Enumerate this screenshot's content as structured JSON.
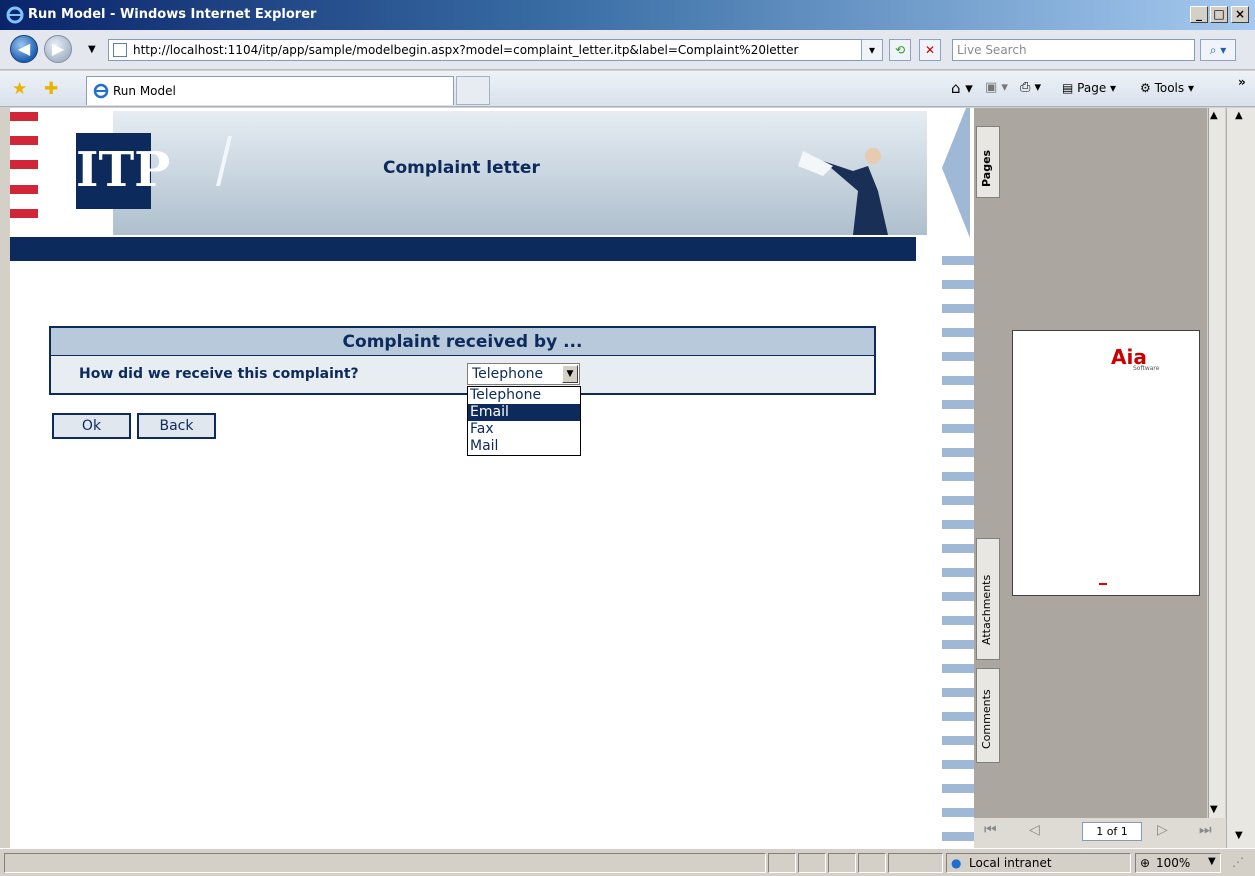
{
  "window": {
    "title": "Run Model - Windows Internet Explorer",
    "minimize": "_",
    "maximize": "□",
    "close": "×"
  },
  "addressbar": {
    "url": "http://localhost:1104/itp/app/sample/modelbegin.aspx?model=complaint_letter.itp&label=Complaint%20letter",
    "search_placeholder": "Live Search"
  },
  "tabs": {
    "active_tab": "Run Model"
  },
  "commandbar": {
    "page_label": "Page",
    "tools_label": "Tools"
  },
  "banner": {
    "logo_text": "ITP",
    "title": "Complaint letter"
  },
  "form": {
    "panel_title": "Complaint received by ...",
    "question": "How did we receive this complaint?",
    "selected_value": "Telephone",
    "options": [
      "Telephone",
      "Email",
      "Fax",
      "Mail"
    ],
    "highlighted_option": "Email",
    "ok_label": "Ok",
    "back_label": "Back"
  },
  "pdf_pane": {
    "tabs": [
      "Pages",
      "Attachments",
      "Comments"
    ],
    "page_indicator": "1 of 1",
    "logo_text": "Aia",
    "logo_subtext": "Software"
  },
  "statusbar": {
    "zone": "Local intranet",
    "zoom": "100%"
  },
  "colors": {
    "brand_navy": "#0d2a5c",
    "brand_red": "#d02638",
    "stripe_blue": "#9eb8d6"
  }
}
